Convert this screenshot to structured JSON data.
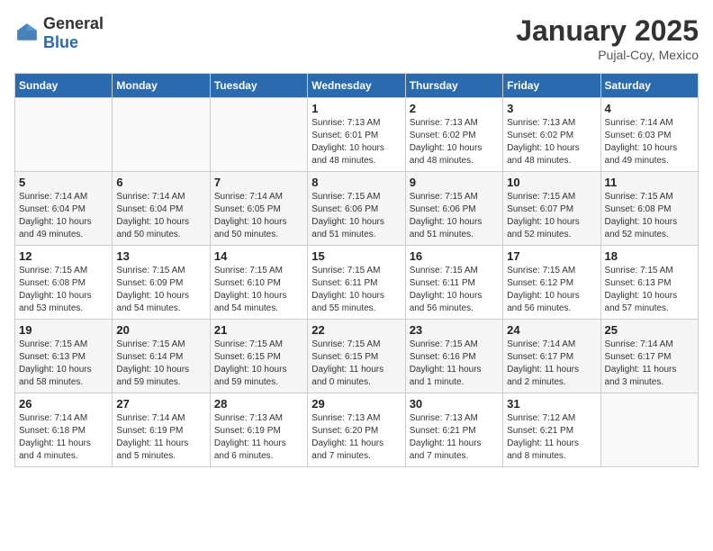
{
  "logo": {
    "general": "General",
    "blue": "Blue"
  },
  "calendar": {
    "title": "January 2025",
    "subtitle": "Pujal-Coy, Mexico"
  },
  "weekdays": [
    "Sunday",
    "Monday",
    "Tuesday",
    "Wednesday",
    "Thursday",
    "Friday",
    "Saturday"
  ],
  "weeks": [
    [
      {
        "day": "",
        "info": ""
      },
      {
        "day": "",
        "info": ""
      },
      {
        "day": "",
        "info": ""
      },
      {
        "day": "1",
        "info": "Sunrise: 7:13 AM\nSunset: 6:01 PM\nDaylight: 10 hours\nand 48 minutes."
      },
      {
        "day": "2",
        "info": "Sunrise: 7:13 AM\nSunset: 6:02 PM\nDaylight: 10 hours\nand 48 minutes."
      },
      {
        "day": "3",
        "info": "Sunrise: 7:13 AM\nSunset: 6:02 PM\nDaylight: 10 hours\nand 48 minutes."
      },
      {
        "day": "4",
        "info": "Sunrise: 7:14 AM\nSunset: 6:03 PM\nDaylight: 10 hours\nand 49 minutes."
      }
    ],
    [
      {
        "day": "5",
        "info": "Sunrise: 7:14 AM\nSunset: 6:04 PM\nDaylight: 10 hours\nand 49 minutes."
      },
      {
        "day": "6",
        "info": "Sunrise: 7:14 AM\nSunset: 6:04 PM\nDaylight: 10 hours\nand 50 minutes."
      },
      {
        "day": "7",
        "info": "Sunrise: 7:14 AM\nSunset: 6:05 PM\nDaylight: 10 hours\nand 50 minutes."
      },
      {
        "day": "8",
        "info": "Sunrise: 7:15 AM\nSunset: 6:06 PM\nDaylight: 10 hours\nand 51 minutes."
      },
      {
        "day": "9",
        "info": "Sunrise: 7:15 AM\nSunset: 6:06 PM\nDaylight: 10 hours\nand 51 minutes."
      },
      {
        "day": "10",
        "info": "Sunrise: 7:15 AM\nSunset: 6:07 PM\nDaylight: 10 hours\nand 52 minutes."
      },
      {
        "day": "11",
        "info": "Sunrise: 7:15 AM\nSunset: 6:08 PM\nDaylight: 10 hours\nand 52 minutes."
      }
    ],
    [
      {
        "day": "12",
        "info": "Sunrise: 7:15 AM\nSunset: 6:08 PM\nDaylight: 10 hours\nand 53 minutes."
      },
      {
        "day": "13",
        "info": "Sunrise: 7:15 AM\nSunset: 6:09 PM\nDaylight: 10 hours\nand 54 minutes."
      },
      {
        "day": "14",
        "info": "Sunrise: 7:15 AM\nSunset: 6:10 PM\nDaylight: 10 hours\nand 54 minutes."
      },
      {
        "day": "15",
        "info": "Sunrise: 7:15 AM\nSunset: 6:11 PM\nDaylight: 10 hours\nand 55 minutes."
      },
      {
        "day": "16",
        "info": "Sunrise: 7:15 AM\nSunset: 6:11 PM\nDaylight: 10 hours\nand 56 minutes."
      },
      {
        "day": "17",
        "info": "Sunrise: 7:15 AM\nSunset: 6:12 PM\nDaylight: 10 hours\nand 56 minutes."
      },
      {
        "day": "18",
        "info": "Sunrise: 7:15 AM\nSunset: 6:13 PM\nDaylight: 10 hours\nand 57 minutes."
      }
    ],
    [
      {
        "day": "19",
        "info": "Sunrise: 7:15 AM\nSunset: 6:13 PM\nDaylight: 10 hours\nand 58 minutes."
      },
      {
        "day": "20",
        "info": "Sunrise: 7:15 AM\nSunset: 6:14 PM\nDaylight: 10 hours\nand 59 minutes."
      },
      {
        "day": "21",
        "info": "Sunrise: 7:15 AM\nSunset: 6:15 PM\nDaylight: 10 hours\nand 59 minutes."
      },
      {
        "day": "22",
        "info": "Sunrise: 7:15 AM\nSunset: 6:15 PM\nDaylight: 11 hours\nand 0 minutes."
      },
      {
        "day": "23",
        "info": "Sunrise: 7:15 AM\nSunset: 6:16 PM\nDaylight: 11 hours\nand 1 minute."
      },
      {
        "day": "24",
        "info": "Sunrise: 7:14 AM\nSunset: 6:17 PM\nDaylight: 11 hours\nand 2 minutes."
      },
      {
        "day": "25",
        "info": "Sunrise: 7:14 AM\nSunset: 6:17 PM\nDaylight: 11 hours\nand 3 minutes."
      }
    ],
    [
      {
        "day": "26",
        "info": "Sunrise: 7:14 AM\nSunset: 6:18 PM\nDaylight: 11 hours\nand 4 minutes."
      },
      {
        "day": "27",
        "info": "Sunrise: 7:14 AM\nSunset: 6:19 PM\nDaylight: 11 hours\nand 5 minutes."
      },
      {
        "day": "28",
        "info": "Sunrise: 7:13 AM\nSunset: 6:19 PM\nDaylight: 11 hours\nand 6 minutes."
      },
      {
        "day": "29",
        "info": "Sunrise: 7:13 AM\nSunset: 6:20 PM\nDaylight: 11 hours\nand 7 minutes."
      },
      {
        "day": "30",
        "info": "Sunrise: 7:13 AM\nSunset: 6:21 PM\nDaylight: 11 hours\nand 7 minutes."
      },
      {
        "day": "31",
        "info": "Sunrise: 7:12 AM\nSunset: 6:21 PM\nDaylight: 11 hours\nand 8 minutes."
      },
      {
        "day": "",
        "info": ""
      }
    ]
  ]
}
